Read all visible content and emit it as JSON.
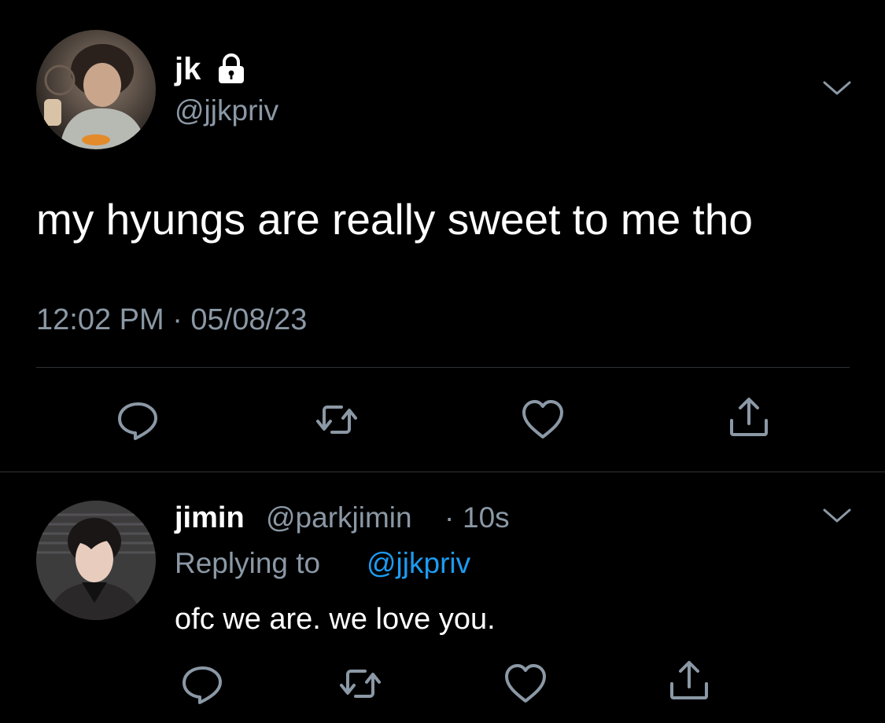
{
  "colors": {
    "background": "#000000",
    "primary_text": "#ffffff",
    "secondary_text": "#8b98a5",
    "icon": "#8b98a5",
    "link": "#1d9bf0",
    "divider": "#2f3336"
  },
  "main_tweet": {
    "display_name": "jk",
    "handle": "@jjkpriv",
    "protected_icon": "lock-icon",
    "text": "my hyungs are really sweet to me tho",
    "timestamp": "12:02 PM · 05/08/23",
    "actions": [
      "reply-icon",
      "retweet-icon",
      "like-icon",
      "share-icon"
    ]
  },
  "reply_tweet": {
    "display_name": "jimin",
    "handle": "@parkjimin",
    "separator": "·",
    "time": "10s",
    "replying_prefix": "Replying to",
    "replying_mention": "@jjkpriv",
    "text": "ofc we are. we love you.",
    "actions": [
      "reply-icon",
      "retweet-icon",
      "like-icon",
      "share-icon"
    ]
  }
}
